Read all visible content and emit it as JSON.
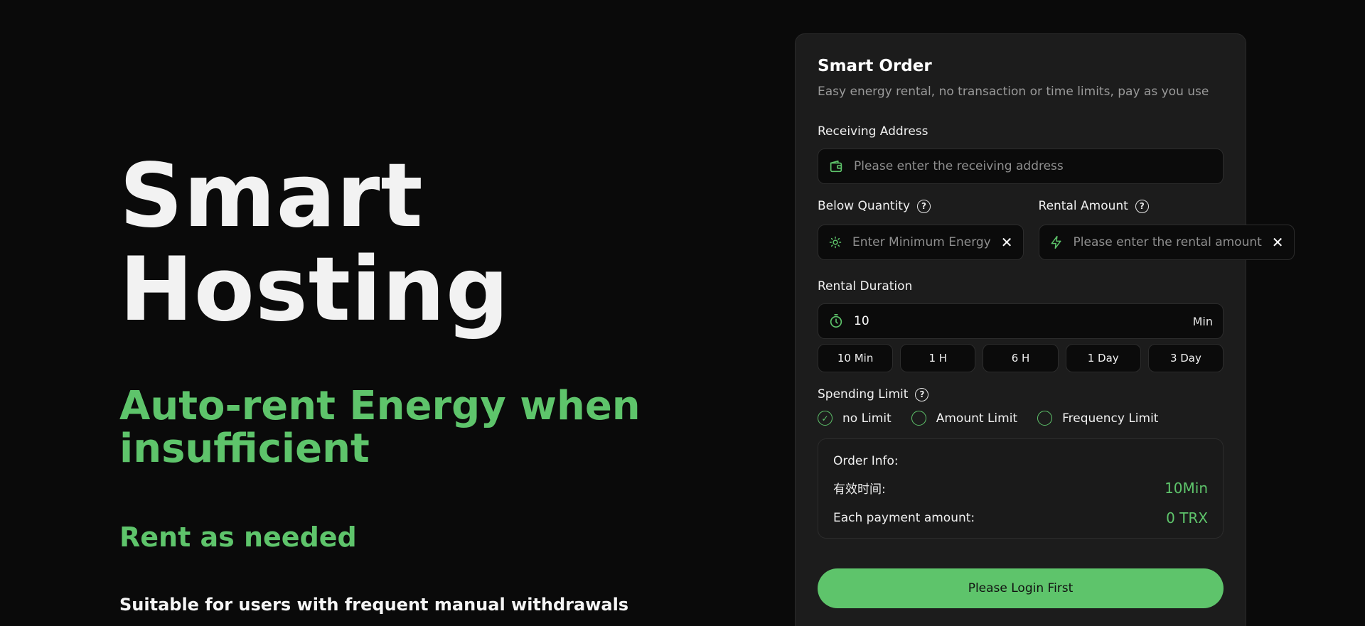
{
  "hero": {
    "title": "Smart Hosting",
    "subtitle": "Auto-rent Energy when insufficient",
    "rent": "Rent as needed",
    "description": "Suitable for users with frequent manual withdrawals"
  },
  "card": {
    "title": "Smart Order",
    "subtitle": "Easy energy rental, no transaction or time limits, pay as you use",
    "receiving_address": {
      "label": "Receiving Address",
      "placeholder": "Please enter the receiving address",
      "icon": "wallet-icon"
    },
    "below_quantity": {
      "label": "Below Quantity",
      "placeholder": "Enter Minimum Energy",
      "icon": "sun-icon"
    },
    "rental_amount": {
      "label": "Rental Amount",
      "placeholder": "Please enter the rental amount",
      "icon": "lightning-icon"
    },
    "rental_duration": {
      "label": "Rental Duration",
      "value": "10",
      "unit": "Min",
      "icon": "timer-icon",
      "options": [
        "10 Min",
        "1 H",
        "6 H",
        "1 Day",
        "3 Day"
      ]
    },
    "spending_limit": {
      "label": "Spending Limit",
      "options": [
        {
          "label": "no Limit",
          "selected": true
        },
        {
          "label": "Amount Limit",
          "selected": false
        },
        {
          "label": "Frequency Limit",
          "selected": false
        }
      ]
    },
    "order_info": {
      "title": "Order Info:",
      "valid_time_label": "有效时间:",
      "valid_time_value": "10Min",
      "payment_label": "Each payment amount:",
      "payment_value": "0 TRX"
    },
    "login_button": "Please Login First"
  },
  "colors": {
    "accent": "#5ec46b",
    "background": "#0a0a0a",
    "card": "#1c1c1c"
  }
}
